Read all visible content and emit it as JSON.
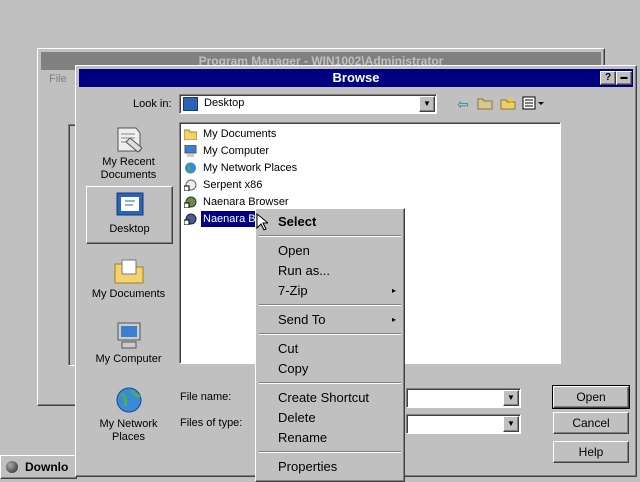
{
  "program_manager": {
    "title": "Program Manager - WIN1002\\Administrator",
    "menu_label": "File"
  },
  "taskbar": {
    "button_label": "Downlo"
  },
  "dialog": {
    "title": "Browse",
    "look_in_label": "Look in:",
    "look_in_value": "Desktop",
    "places": [
      {
        "label": "My Recent Documents",
        "icon": "recent-documents-icon"
      },
      {
        "label": "Desktop",
        "icon": "desktop-icon"
      },
      {
        "label": "My Documents",
        "icon": "my-documents-icon"
      },
      {
        "label": "My Computer",
        "icon": "my-computer-icon"
      },
      {
        "label": "My Network Places",
        "icon": "network-places-icon"
      }
    ],
    "files": [
      {
        "label": "My Documents",
        "icon": "folder-icon"
      },
      {
        "label": "My Computer",
        "icon": "computer-icon"
      },
      {
        "label": "My Network Places",
        "icon": "network-icon"
      },
      {
        "label": "Serpent x86",
        "icon": "shortcut-icon"
      },
      {
        "label": "Naenara Browser",
        "icon": "shortcut-icon"
      },
      {
        "label": "Naenara Br",
        "icon": "shortcut-icon"
      }
    ],
    "file_name_label": "File name:",
    "file_name_value": "",
    "files_of_type_label": "Files of type:",
    "files_of_type_value": "",
    "open_label": "Open",
    "cancel_label": "Cancel",
    "help_label": "Help",
    "title_help_glyph": "?",
    "title_close_glyph": "▬"
  },
  "context_menu": {
    "items": [
      "Select",
      "Open",
      "Run as...",
      "7-Zip",
      "Send To",
      "Cut",
      "Copy",
      "Create Shortcut",
      "Delete",
      "Rename",
      "Properties"
    ],
    "submenu_arrow": "▸"
  },
  "colors": {
    "titlebar_active": "#000080",
    "titlebar_inactive": "#808080",
    "face": "#c0c0c0",
    "selection": "#000080"
  }
}
